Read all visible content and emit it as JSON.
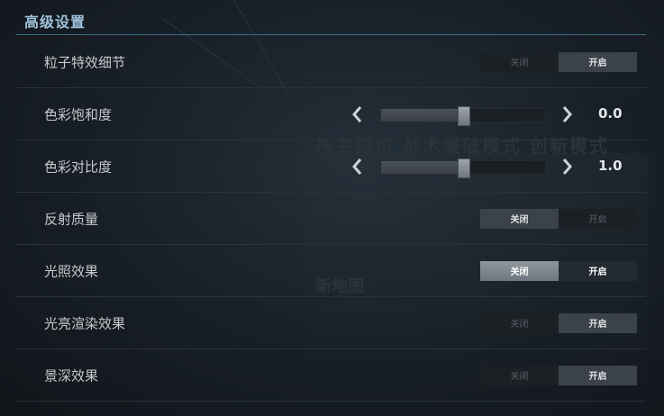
{
  "panel": {
    "title": "高级设置"
  },
  "background": {
    "ghost_tabs": "核主排位    战术爆破模式    创新模式",
    "ghost_map": "新地图"
  },
  "settings": [
    {
      "label": "粒子特效细节",
      "type": "toggle",
      "options": [
        "关闭",
        "开启"
      ],
      "selected": "开启"
    },
    {
      "label": "色彩饱和度",
      "type": "slider",
      "value_text": "0.0",
      "level": 0.5
    },
    {
      "label": "色彩对比度",
      "type": "slider",
      "value_text": "1.0",
      "level": 0.5
    },
    {
      "label": "反射质量",
      "type": "toggle",
      "options": [
        "关闭",
        "开启"
      ],
      "selected": "关闭"
    },
    {
      "label": "光照效果",
      "type": "toggle",
      "options": [
        "关闭",
        "开启"
      ],
      "selected": "开启"
    },
    {
      "label": "光亮渲染效果",
      "type": "toggle",
      "options": [
        "关闭",
        "开启"
      ],
      "selected": "开启"
    },
    {
      "label": "景深效果",
      "type": "toggle",
      "options": [
        "关闭",
        "开启"
      ],
      "selected": "开启"
    }
  ],
  "colors": {
    "accent": "#3d6d8a",
    "title": "#9fc3dc"
  }
}
